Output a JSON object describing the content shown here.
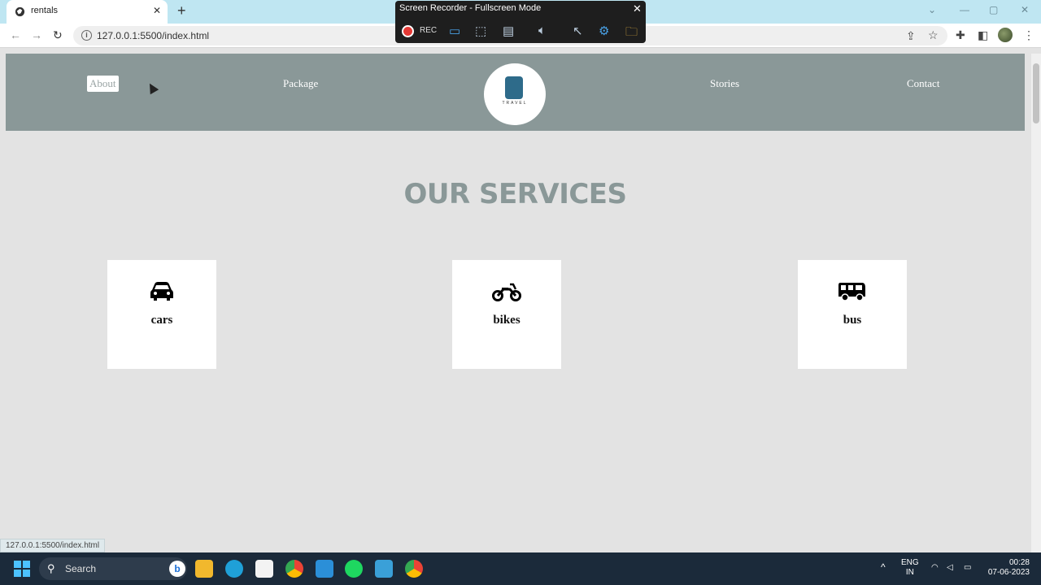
{
  "browser": {
    "tab_title": "rentals",
    "url": "127.0.0.1:5500/index.html",
    "status_url": "127.0.0.1:5500/index.html"
  },
  "recorder": {
    "title": "Screen Recorder - Fullscreen Mode",
    "rec_label": "REC"
  },
  "site": {
    "nav": [
      "About",
      "Package",
      "Stories",
      "Contact"
    ],
    "logo_text": "TRAVEL",
    "section_title": "OUR SERVICES",
    "services": [
      {
        "label": "cars",
        "icon": "car-icon"
      },
      {
        "label": "bikes",
        "icon": "motorcycle-icon"
      },
      {
        "label": "bus",
        "icon": "bus-icon"
      }
    ],
    "colors": {
      "header": "#8a9898",
      "background": "#e3e3e3",
      "card": "#ffffff"
    }
  },
  "taskbar": {
    "search_placeholder": "Search",
    "lang_top": "ENG",
    "lang_bottom": "IN",
    "time": "00:28",
    "date": "07-06-2023"
  }
}
